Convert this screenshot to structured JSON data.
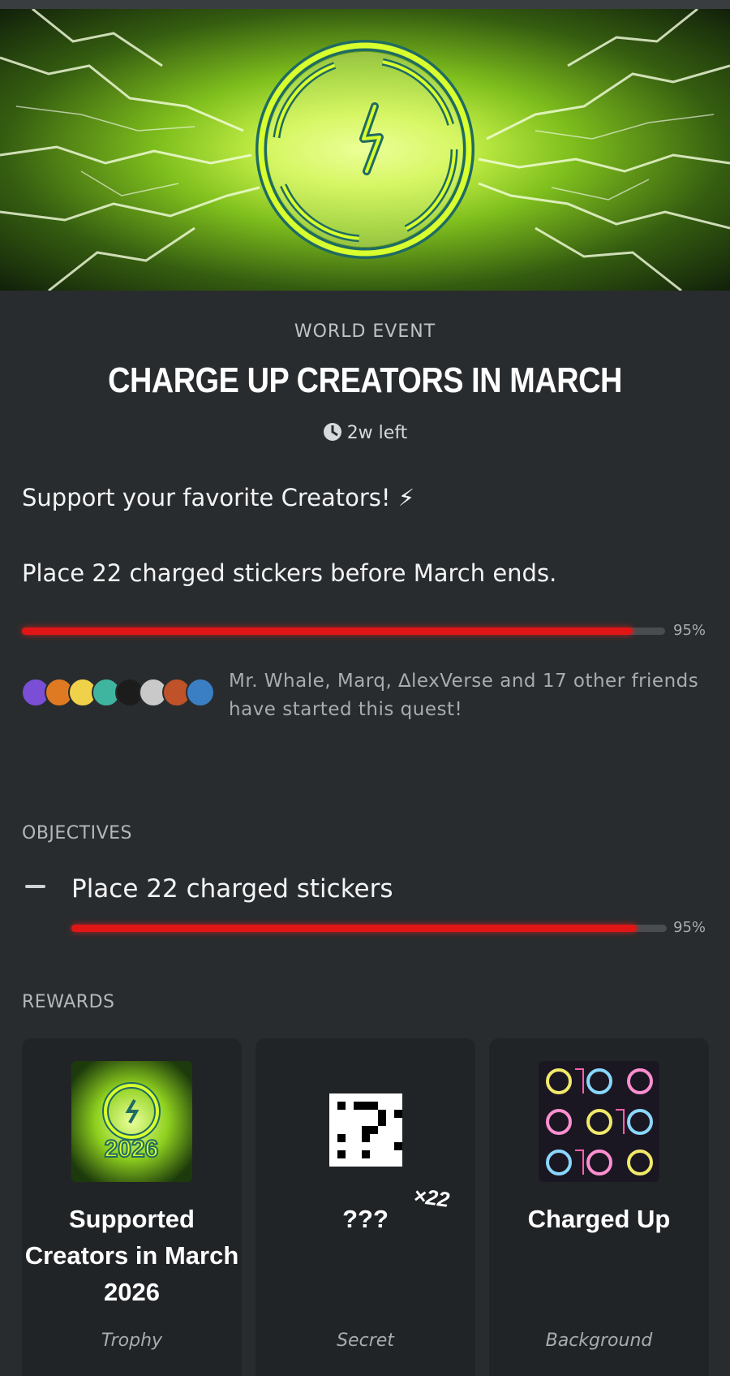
{
  "event": {
    "kicker": "WORLD EVENT",
    "title": "CHARGE UP CREATORS IN MARCH",
    "time_left": "2w left"
  },
  "description": {
    "line1": "Support your favorite Creators! ⚡",
    "line2": "Place 22 charged stickers before March ends."
  },
  "progress": {
    "fraction": 0.95,
    "label": "95%"
  },
  "friends": {
    "text": "Mr. Whale, Marq, ∆lexVerse and 17 other friends have started this quest!",
    "avatar_colors": [
      "#7a4fd6",
      "#e07a22",
      "#f0d24a",
      "#3fb5a0",
      "#1c1c1c",
      "#c9c9c9",
      "#c0522a",
      "#3a7ec4"
    ]
  },
  "objectives": {
    "label": "OBJECTIVES",
    "items": [
      {
        "text": "Place 22 charged stickers",
        "fraction": 0.95,
        "label": "95%"
      }
    ]
  },
  "rewards": {
    "label": "REWARDS",
    "items": [
      {
        "name": "Supported Creators in March 2026",
        "type": "Trophy",
        "badge_text": "2026"
      },
      {
        "name": "???",
        "type": "Secret",
        "quantity": "×22"
      },
      {
        "name": "Charged Up",
        "type": "Background"
      }
    ]
  },
  "colors": {
    "background": "#292c2e",
    "card": "#212426",
    "progress": "#e01616",
    "accent": "#c9f24a"
  }
}
